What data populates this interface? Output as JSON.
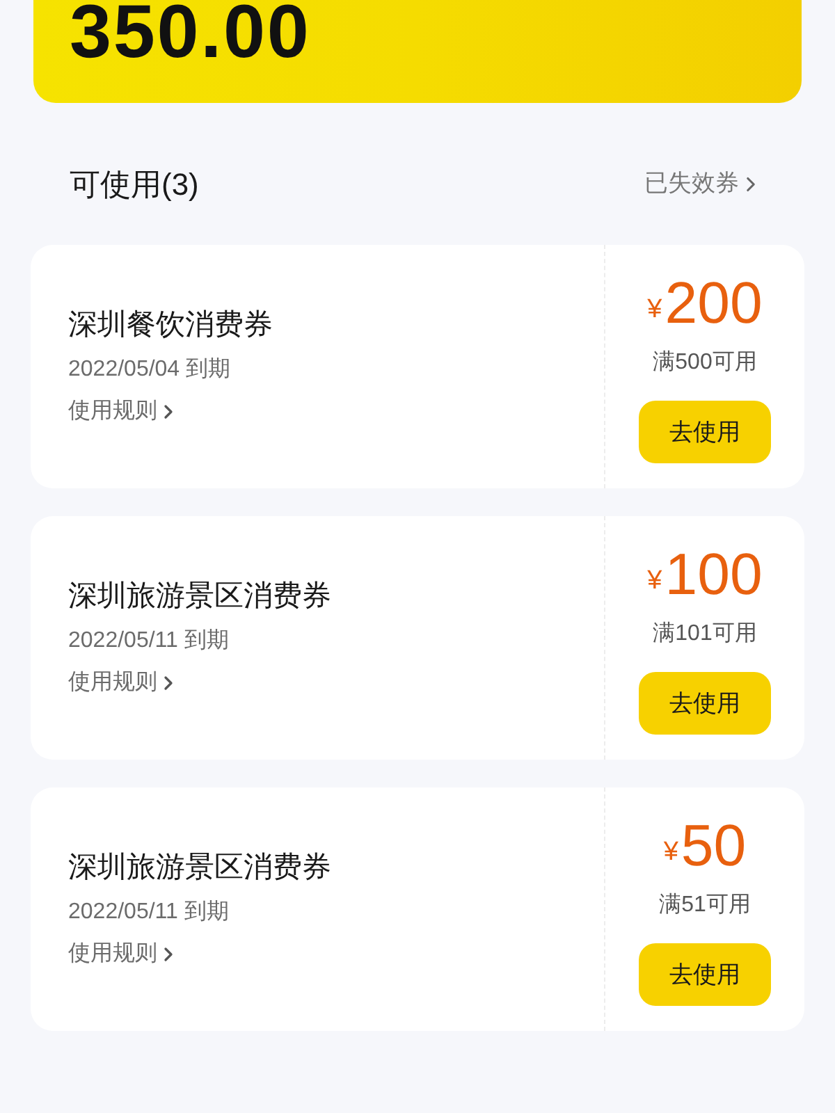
{
  "balance": {
    "amount": "350.00"
  },
  "section": {
    "title": "可使用(3)",
    "link": "已失效券"
  },
  "coupons": [
    {
      "title": "深圳餐饮消费券",
      "expiry": "2022/05/04 到期",
      "rules_link": "使用规则",
      "currency": "¥",
      "amount": "200",
      "condition": "满500可用",
      "button": "去使用"
    },
    {
      "title": "深圳旅游景区消费券",
      "expiry": "2022/05/11 到期",
      "rules_link": "使用规则",
      "currency": "¥",
      "amount": "100",
      "condition": "满101可用",
      "button": "去使用"
    },
    {
      "title": "深圳旅游景区消费券",
      "expiry": "2022/05/11 到期",
      "rules_link": "使用规则",
      "currency": "¥",
      "amount": "50",
      "condition": "满51可用",
      "button": "去使用"
    }
  ]
}
